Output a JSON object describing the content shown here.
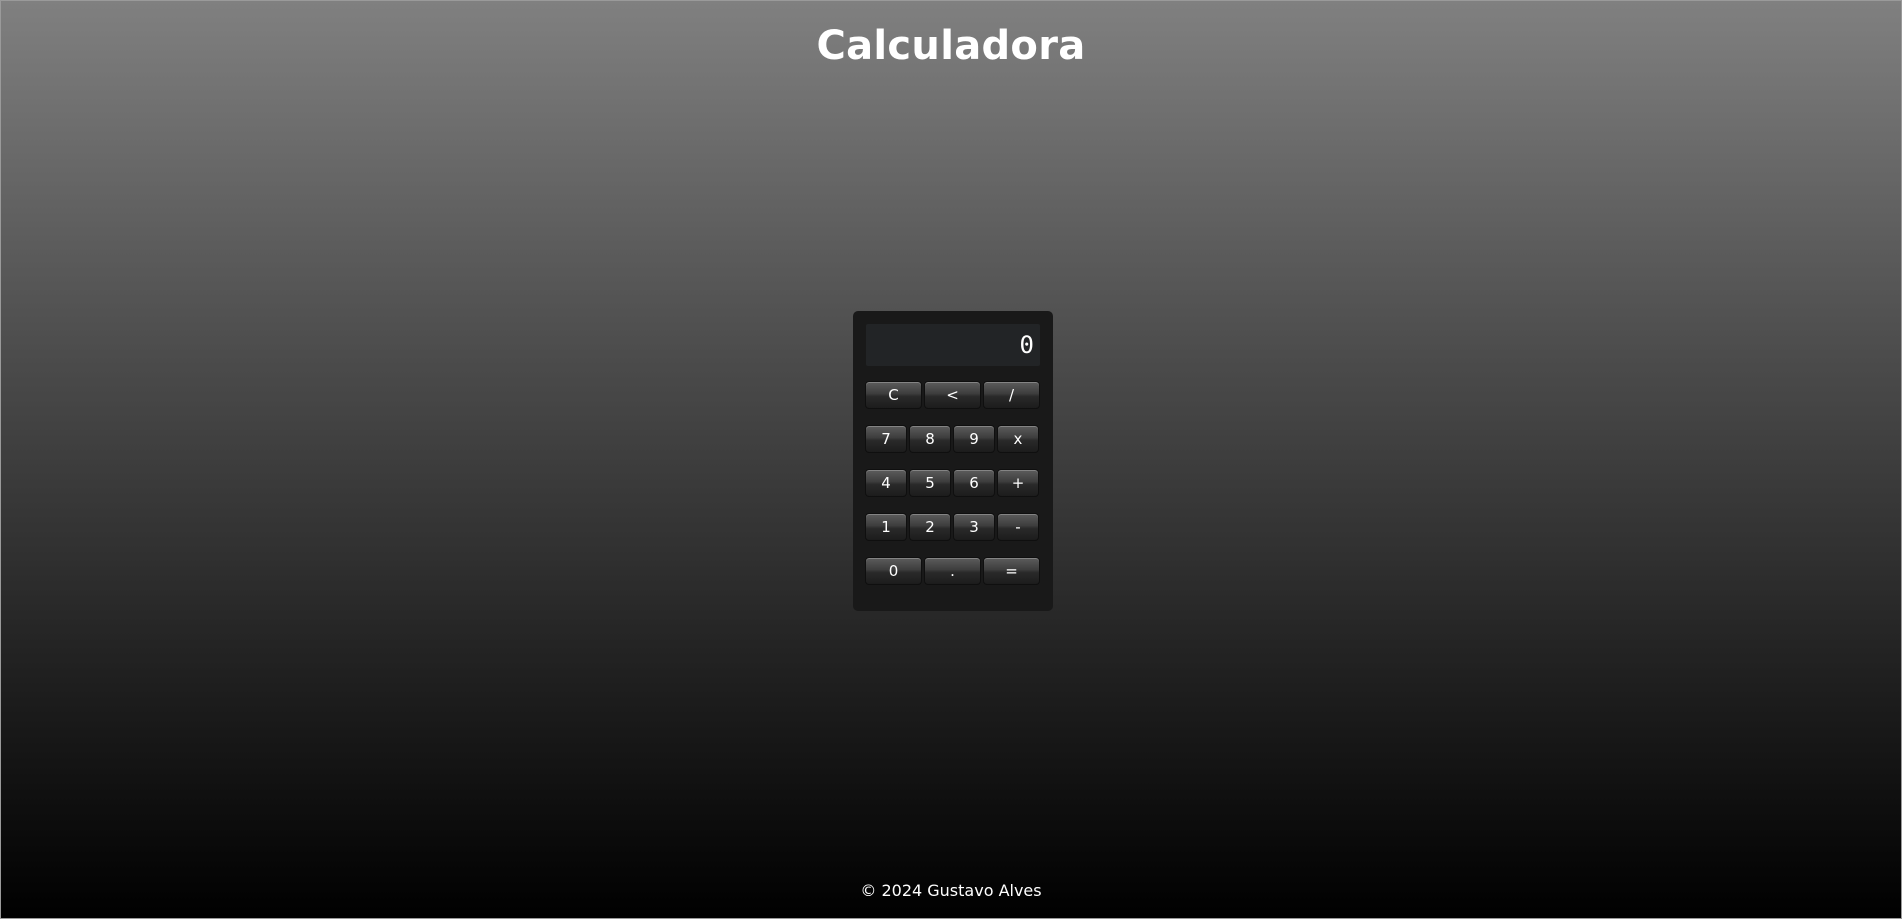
{
  "header": {
    "title": "Calculadora"
  },
  "calculator": {
    "display_value": "0",
    "rows": [
      [
        "C",
        "<",
        "/"
      ],
      [
        "7",
        "8",
        "9",
        "x"
      ],
      [
        "4",
        "5",
        "6",
        "+"
      ],
      [
        "1",
        "2",
        "3",
        "-"
      ],
      [
        "0",
        ".",
        "="
      ]
    ]
  },
  "footer": {
    "text": "© 2024 Gustavo Alves"
  }
}
